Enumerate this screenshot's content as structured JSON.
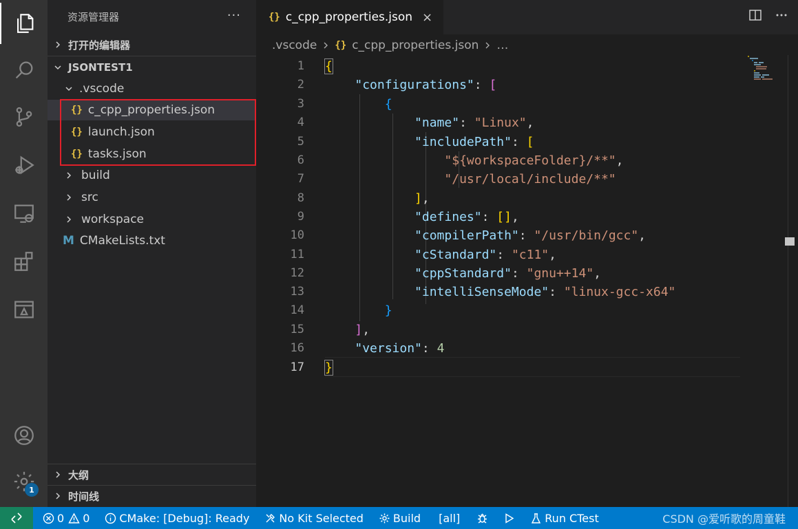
{
  "sidebar": {
    "title": "资源管理器",
    "more": "···",
    "open_editors": "打开的编辑器",
    "workspace": "JSONTEST1",
    "tree": [
      {
        "label": ".vscode",
        "type": "folder-open"
      },
      {
        "label": "c_cpp_properties.json",
        "type": "json"
      },
      {
        "label": "launch.json",
        "type": "json"
      },
      {
        "label": "tasks.json",
        "type": "json"
      },
      {
        "label": "build",
        "type": "folder"
      },
      {
        "label": "src",
        "type": "folder"
      },
      {
        "label": "workspace",
        "type": "folder"
      },
      {
        "label": "CMakeLists.txt",
        "type": "cmake"
      }
    ],
    "outline": "大纲",
    "timeline": "时间线"
  },
  "icons": {
    "json": "{}",
    "cmake": "M"
  },
  "tab": {
    "label": "c_cpp_properties.json",
    "close": "×"
  },
  "breadcrumb": {
    "folder": ".vscode",
    "file": "c_cpp_properties.json",
    "more": "…"
  },
  "editor": {
    "line_numbers": [
      "1",
      "2",
      "3",
      "4",
      "5",
      "6",
      "7",
      "8",
      "9",
      "10",
      "11",
      "12",
      "13",
      "14",
      "15",
      "16",
      "17"
    ],
    "current_line": "17"
  },
  "statusbar": {
    "errors": "0",
    "warnings": "0",
    "cmake_status": "CMake: [Debug]: Ready",
    "kit": "No Kit Selected",
    "build": "Build",
    "target": "[all]",
    "run_ctest": "Run CTest",
    "watermark": "CSDN @爱听歌的周童鞋"
  },
  "activity": {
    "badge": "1"
  },
  "colors": {
    "activity_bg": "#333333",
    "sidebar_bg": "#252526",
    "editor_bg": "#1e1e1e",
    "statusbar_bg": "#007acc",
    "remote_bg": "#16825d",
    "highlight_box": "#e0202a"
  }
}
